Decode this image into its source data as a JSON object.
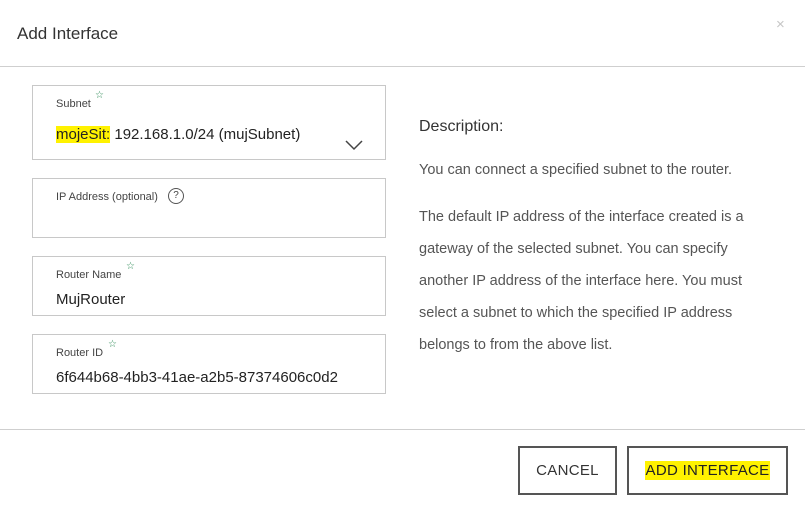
{
  "dialog": {
    "title": "Add Interface",
    "close_glyph": "×"
  },
  "form": {
    "subnet": {
      "label": "Subnet",
      "value_network": "mojeSit:",
      "value_rest": " 192.168.1.0/24 (mujSubnet)",
      "required": true
    },
    "ip_address": {
      "label": "IP Address (optional)",
      "help_glyph": "?",
      "value": ""
    },
    "router_name": {
      "label": "Router Name",
      "value": "MujRouter",
      "required": true
    },
    "router_id": {
      "label": "Router ID",
      "value": "6f644b68-4bb3-41ae-a2b5-87374606c0d2",
      "required": true
    },
    "required_glyph": "☆"
  },
  "description": {
    "heading": "Description:",
    "paragraph1": "You can connect a specified subnet to the router.",
    "paragraph2": "The default IP address of the interface created is a gateway of the selected subnet. You can specify another IP address of the interface here. You must select a subnet to which the specified IP address belongs to from the above list."
  },
  "footer": {
    "cancel_label": "CANCEL",
    "add_label": "ADD INTERFACE"
  },
  "colors": {
    "highlight": "#fff200",
    "star": "#2e8b57",
    "border": "#c8c8c8"
  },
  "icons": {
    "close": "close-icon",
    "dropdown": "chevron-down-icon",
    "help": "question-circle-icon",
    "required": "star-icon"
  }
}
